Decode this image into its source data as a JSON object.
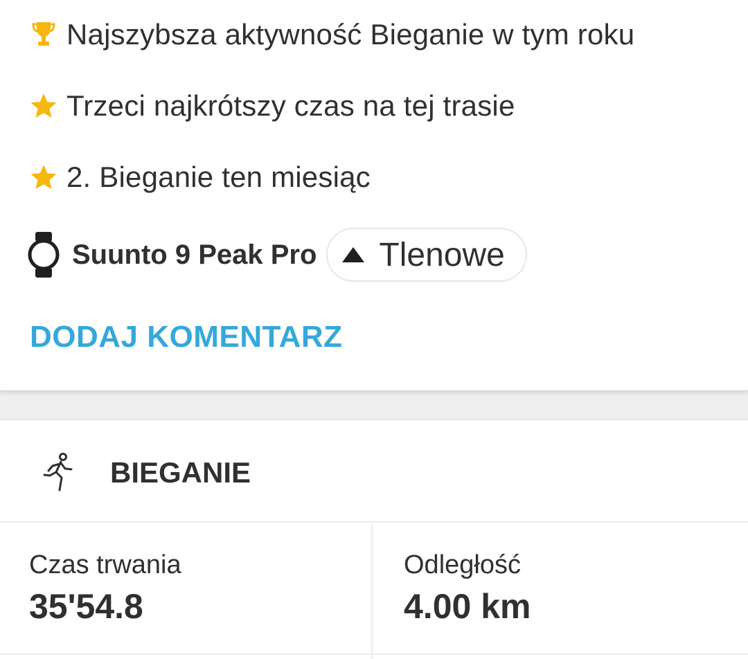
{
  "achievements": [
    {
      "icon": "trophy-icon",
      "text": "Najszybsza aktywność Bieganie w tym roku"
    },
    {
      "icon": "star-icon",
      "text": "Trzeci najkrótszy czas na tej trasie"
    },
    {
      "icon": "star-icon",
      "text": "2. Bieganie ten miesiąc"
    }
  ],
  "device": {
    "icon": "watch-icon",
    "name": "Suunto 9 Peak Pro"
  },
  "training_effect": {
    "icon": "triangle-up-icon",
    "label": "Tlenowe"
  },
  "comment_button": "DODAJ KOMENTARZ",
  "activity": {
    "icon": "running-icon",
    "title": "BIEGANIE"
  },
  "stats": [
    {
      "label": "Czas trwania",
      "value": "35'54.8"
    },
    {
      "label": "Odległość",
      "value": "4.00 km"
    }
  ],
  "colors": {
    "accent": "#35a8db",
    "gold": "#f6b70f",
    "text": "#303030",
    "divider": "#ececec"
  }
}
